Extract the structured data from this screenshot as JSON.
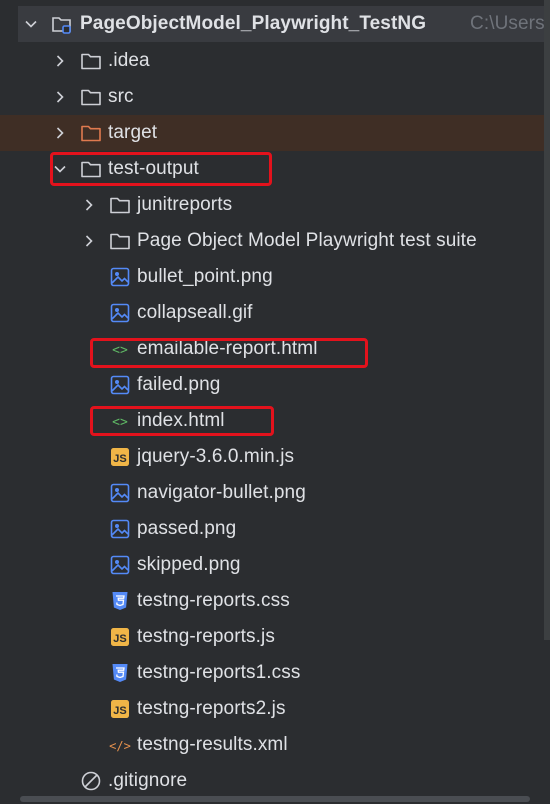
{
  "project": {
    "name": "PageObjectModel_Playwright_TestNG",
    "path_hint": "C:\\Users"
  },
  "tree": [
    {
      "label": ".idea",
      "type": "folder"
    },
    {
      "label": "src",
      "type": "folder"
    },
    {
      "label": "target",
      "type": "folder-excluded"
    },
    {
      "label": "test-output",
      "type": "folder-open",
      "highlighted": true
    },
    {
      "label": "junitreports",
      "type": "folder"
    },
    {
      "label": "Page Object Model Playwright test suite",
      "type": "folder"
    },
    {
      "label": "bullet_point.png",
      "type": "image-file"
    },
    {
      "label": "collapseall.gif",
      "type": "image-file"
    },
    {
      "label": "emailable-report.html",
      "type": "html-file",
      "highlighted": true
    },
    {
      "label": "failed.png",
      "type": "image-file"
    },
    {
      "label": "index.html",
      "type": "html-file",
      "highlighted": true
    },
    {
      "label": "jquery-3.6.0.min.js",
      "type": "js-file"
    },
    {
      "label": "navigator-bullet.png",
      "type": "image-file"
    },
    {
      "label": "passed.png",
      "type": "image-file"
    },
    {
      "label": "skipped.png",
      "type": "image-file"
    },
    {
      "label": "testng-reports.css",
      "type": "css-file"
    },
    {
      "label": "testng-reports.js",
      "type": "js-file"
    },
    {
      "label": "testng-reports1.css",
      "type": "css-file"
    },
    {
      "label": "testng-reports2.js",
      "type": "js-file"
    },
    {
      "label": "testng-results.xml",
      "type": "xml-file"
    },
    {
      "label": ".gitignore",
      "type": "ignore-file"
    }
  ],
  "icon_glyphs": {
    "js": "JS",
    "html": "<>",
    "xml": "</>"
  },
  "colors": {
    "background": "#2b2d30",
    "root_row": "#393b40",
    "target_row": "#3f2e25",
    "highlight_box": "#e3121c",
    "image_icon": "#548af7",
    "html_icon": "#5fb865",
    "js_icon": "#f0b547",
    "xml_icon": "#e6924e",
    "folder_icon": "#ced0d6",
    "excluded_folder": "#e07a4f"
  }
}
